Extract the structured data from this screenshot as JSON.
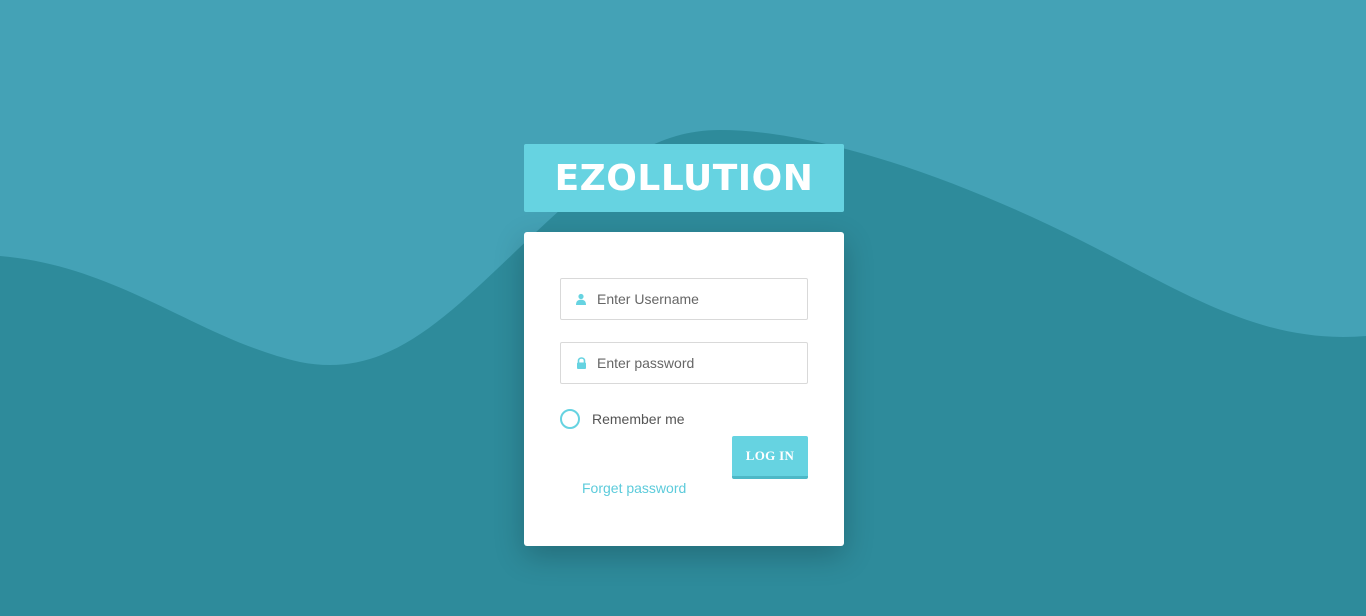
{
  "brand": {
    "title": "EZOLLUTION"
  },
  "login_form": {
    "username_placeholder": "Enter Username",
    "password_placeholder": "Enter password",
    "remember_label": "Remember me",
    "login_button_label": "LOG IN",
    "forget_password_label": "Forget password"
  },
  "icons": {
    "username": "user-icon",
    "password": "lock-icon"
  },
  "colors": {
    "background_light": "#44a2b6",
    "background_dark": "#2e8b9b",
    "accent": "#66d3e1",
    "card": "#ffffff"
  }
}
